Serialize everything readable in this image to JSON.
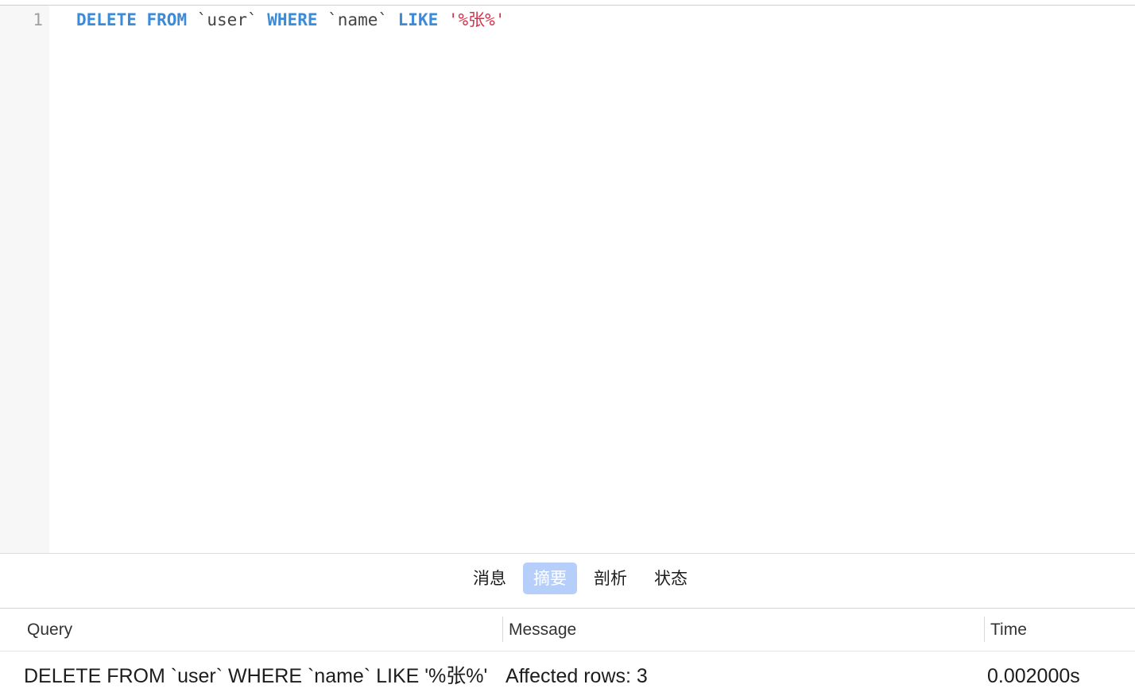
{
  "editor": {
    "line_number": "1",
    "tokens": {
      "kw_delete": "DELETE",
      "kw_from": "FROM",
      "table": "`user`",
      "kw_where": "WHERE",
      "column": "`name`",
      "kw_like": "LIKE",
      "pattern": "'%张%'"
    },
    "colors": {
      "keyword": "#3b8bdb",
      "string": "#d8324a",
      "identifier": "#444444"
    }
  },
  "tabs": [
    {
      "label": "消息",
      "active": false
    },
    {
      "label": "摘要",
      "active": true
    },
    {
      "label": "剖析",
      "active": false
    },
    {
      "label": "状态",
      "active": false
    }
  ],
  "results": {
    "columns": [
      "Query",
      "Message",
      "Time"
    ],
    "rows": [
      {
        "query": "DELETE FROM `user` WHERE `name` LIKE '%张%'",
        "message": "Affected rows: 3",
        "time": "0.002000s"
      }
    ]
  }
}
